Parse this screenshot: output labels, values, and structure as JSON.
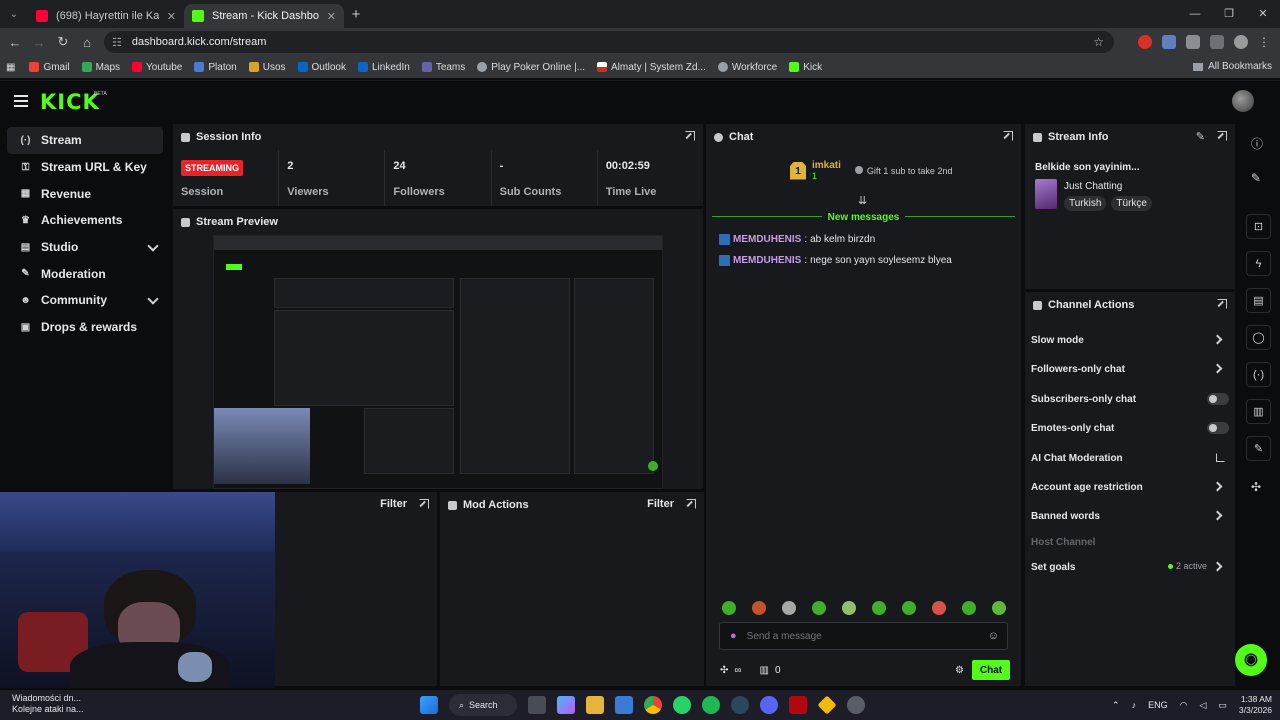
{
  "browser": {
    "tabs": [
      {
        "title": "(698) Hayrettin ile Kaos Show -",
        "active": false,
        "favicon_color": "#ff0033"
      },
      {
        "title": "Stream - Kick Dashboard",
        "active": true,
        "favicon_color": "#53fc18"
      }
    ],
    "url": "dashboard.kick.com/stream",
    "bookmarks": [
      "Gmail",
      "Maps",
      "Youtube",
      "Platon",
      "Usos",
      "Outlook",
      "LinkedIn",
      "Teams",
      "Play Poker Online |...",
      "Almaty | System Zd...",
      "Workforce",
      "Kick"
    ],
    "all_bookmarks": "All Bookmarks"
  },
  "header": {
    "logo": "KICK",
    "beta": "BETA"
  },
  "sidebar": {
    "items": [
      {
        "label": "Stream",
        "icon": "link-icon",
        "active": true
      },
      {
        "label": "Stream URL & Key",
        "icon": "key-icon",
        "active": false
      },
      {
        "label": "Revenue",
        "icon": "revenue-icon",
        "active": false
      },
      {
        "label": "Achievements",
        "icon": "trophy-icon",
        "active": false
      },
      {
        "label": "Studio",
        "icon": "studio-icon",
        "active": false,
        "expandable": true
      },
      {
        "label": "Moderation",
        "icon": "wrench-icon",
        "active": false
      },
      {
        "label": "Community",
        "icon": "community-icon",
        "active": false,
        "expandable": true
      },
      {
        "label": "Drops & rewards",
        "icon": "gift-icon",
        "active": false
      }
    ]
  },
  "session": {
    "title": "Session Info",
    "status": "STREAMING",
    "status_label": "Session",
    "viewers": "2",
    "viewers_label": "Viewers",
    "followers": "24",
    "followers_label": "Followers",
    "subs": "-",
    "subs_label": "Sub Counts",
    "time": "00:02:59",
    "time_label": "Time Live"
  },
  "preview": {
    "title": "Stream Preview"
  },
  "filter_panel": {
    "filter": "Filter"
  },
  "mod_actions": {
    "title": "Mod Actions",
    "filter": "Filter"
  },
  "chat": {
    "title": "Chat",
    "sub_user": "imkati",
    "sub_rank": "1",
    "sub_count": "1",
    "gift_prompt": "Gift 1 sub to take 2nd",
    "new_messages": "New messages",
    "messages": [
      {
        "user": "MEMDUHENIS",
        "text": "ab kelm birzdn"
      },
      {
        "user": "MEMDUHENIS",
        "text": "nege son yayn soylesemz blyea"
      }
    ],
    "placeholder": "Send a message",
    "goal_symbol": "∞",
    "gift_count": "0",
    "send": "Chat"
  },
  "stream_info": {
    "title": "Stream Info",
    "stream_title": "Belkide son yayinim...",
    "category": "Just Chatting",
    "tags": [
      "Turkish",
      "Türkçe"
    ]
  },
  "channel_actions": {
    "title": "Channel Actions",
    "rows": [
      {
        "label": "Slow mode",
        "kind": "arrow"
      },
      {
        "label": "Followers-only chat",
        "kind": "arrow"
      },
      {
        "label": "Subscribers-only chat",
        "kind": "toggle"
      },
      {
        "label": "Emotes-only chat",
        "kind": "toggle"
      },
      {
        "label": "AI Chat Moderation",
        "kind": "link"
      },
      {
        "label": "Account age restriction",
        "kind": "arrow"
      },
      {
        "label": "Banned words",
        "kind": "arrow"
      },
      {
        "label": "Host Channel",
        "kind": "disabled"
      },
      {
        "label": "Set goals",
        "kind": "arrow"
      }
    ],
    "goals_active": "2 active"
  },
  "taskbar": {
    "notification_line1": "Wiadomości dn...",
    "notification_line2": "Kolejne ataki na...",
    "search": "Search",
    "language": "ENG",
    "time": "1:38 AM",
    "date": "3/3/2026"
  },
  "colors": {
    "accent": "#53fc18",
    "live": "#e8242b",
    "panel": "#18191c",
    "background": "#0b0c0e"
  }
}
